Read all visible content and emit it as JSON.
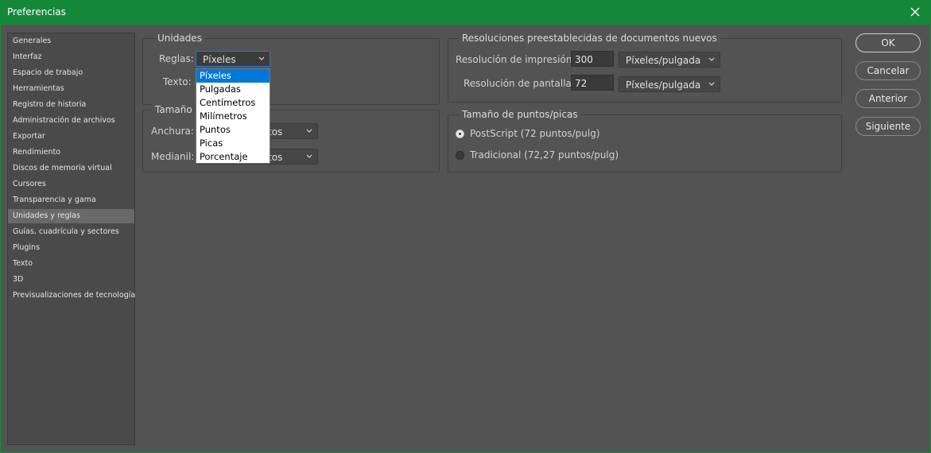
{
  "window": {
    "title": "Preferencias"
  },
  "sidebar": {
    "items": [
      {
        "label": "Generales"
      },
      {
        "label": "Interfaz"
      },
      {
        "label": "Espacio de trabajo"
      },
      {
        "label": "Herramientas"
      },
      {
        "label": "Registro de historia"
      },
      {
        "label": "Administración de archivos"
      },
      {
        "label": "Exportar"
      },
      {
        "label": "Rendimiento"
      },
      {
        "label": "Discos de memoria virtual"
      },
      {
        "label": "Cursores"
      },
      {
        "label": "Transparencia y gama"
      },
      {
        "label": "Unidades y reglas"
      },
      {
        "label": "Guías, cuadrícula y sectores"
      },
      {
        "label": "Plugins"
      },
      {
        "label": "Texto"
      },
      {
        "label": "3D"
      },
      {
        "label": "Previsualizaciones de tecnología"
      }
    ],
    "selected": "Unidades y reglas"
  },
  "units": {
    "title": "Unidades",
    "rulers_label": "Reglas:",
    "rulers_value": "Píxeles",
    "type_label": "Texto:",
    "dropdown_options": [
      "Píxeles",
      "Pulgadas",
      "Centímetros",
      "Milímetros",
      "Puntos",
      "Picas",
      "Porcentaje"
    ]
  },
  "column_size": {
    "title": "Tamaño",
    "width_label": "Anchura:",
    "width_unit_partial": "tos",
    "gutter_label": "Medianil:",
    "gutter_unit_partial": "tos"
  },
  "resolutions": {
    "title": "Resoluciones preestablecidas de documentos nuevos",
    "print_label": "Resolución de impresión:",
    "print_value": "300",
    "print_unit": "Píxeles/pulgada",
    "screen_label": "Resolución de pantalla:",
    "screen_value": "72",
    "screen_unit": "Píxeles/pulgada"
  },
  "point_size": {
    "title": "Tamaño de puntos/picas",
    "postscript": "PostScript (72 puntos/pulg)",
    "traditional": "Tradicional (72,27 puntos/pulg)",
    "selected": "postscript"
  },
  "buttons": {
    "ok": "OK",
    "cancel": "Cancelar",
    "prev": "Anterior",
    "next": "Siguiente"
  },
  "colors": {
    "titlebar": "#16883a",
    "background": "#535353",
    "selection": "#0078d7"
  }
}
